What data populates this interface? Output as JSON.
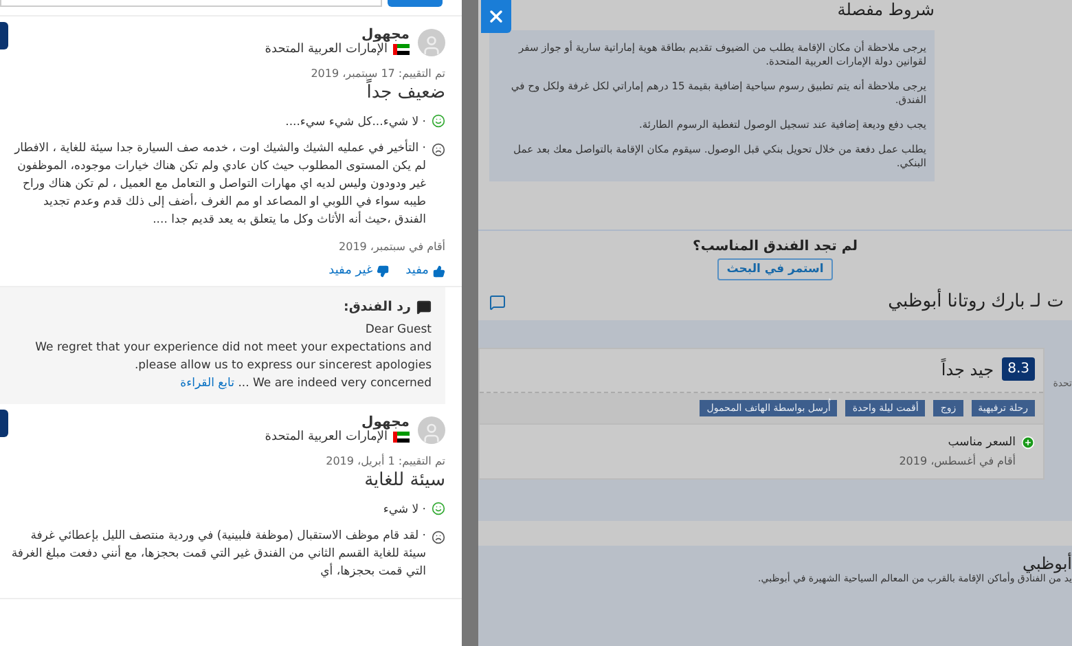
{
  "review_panel": {
    "reviews": [
      {
        "reviewer": "مجهول",
        "country": "الإمارات العربية المتحدة",
        "review_date": "تم التقييم: 17 سبتمبر، 2019",
        "title": "ضعيف جداً",
        "liked": "· لا شيء...كل شيء سيء....",
        "disliked": "· التأخير في عمليه الشيك والشيك اوت ، خدمه صف السيارة جدا سيئة للغاية ، الافطار لم يكن المستوى المطلوب حيث كان عادي ولم تكن هناك خيارات موجوده، الموظفون غير ودودون وليس لديه اي مهارات التواصل و التعامل مع العميل ، لم تكن هناك وراح طيبه سواء في اللوبي او المصاعد او مم الغرف ،أضف إلى ذلك قدم وعدم تجديد الفندق ،حيث أنه الأثاث وكل ما يتعلق به يعد قديم جدا ....",
        "stay_date": "أقام في سبتمبر، 2019",
        "helpful": "مفيد",
        "not_helpful": "غير مفيد",
        "hotel_reply": {
          "heading": "رد الفندق:",
          "greeting": "Dear Guest",
          "body": "We regret that your experience did not meet your expectations and please allow us to express our sincerest apologies.",
          "last_line": "We are indeed very concerned ...",
          "read_more": "تابع القراءة"
        }
      },
      {
        "reviewer": "مجهول",
        "country": "الإمارات العربية المتحدة",
        "review_date": "تم التقييم: 1 أبريل، 2019",
        "title": "سيئة للغاية",
        "liked": "· لا شيء",
        "disliked": "· لقد قام موظف الاستقبال (موظفة فلبينية) في وردية منتصف الليل بإعطائي غرفة سيئة للغاية القسم الثاني من الفندق غير التي قمت بحجزها، مع أنني دفعت مبلغ الغرفة التي قمت بحجزها، أي"
      }
    ]
  },
  "terms": {
    "heading": "شروط مفصلة",
    "paragraphs": [
      "يرجى ملاحظة أن مكان الإقامة يطلب من الضيوف تقديم بطاقة هوية إماراتية سارية أو جواز سفر لقوانين دولة الإمارات العربية المتحدة.",
      "يرجى ملاحظة أنه يتم تطبيق رسوم سياحية إضافية بقيمة 15 درهم إماراتي لكل غرفة ولكل وح في الفندق.",
      "يجب دفع وديعة إضافية عند تسجيل الوصول لتغطية الرسوم الطارئة.",
      "يطلب عمل دفعة من خلال تحويل بنكي قبل الوصول. سيقوم مكان الإقامة بالتواصل معك بعد عمل البنكي."
    ]
  },
  "search_prompt": {
    "question": "لم تجد الفندق المناسب؟",
    "button": "استمر في البحث"
  },
  "reviews_section": {
    "heading": "ت لـ بارك روتانا أبوظبي",
    "side_label": "تحدة",
    "card": {
      "score": "8.3",
      "rating": "جيد جداً",
      "tags": [
        "رحلة ترفيهية",
        "زوج",
        "أقمت ليلة واحدة",
        "أُرسل بواسطة الهاتف المحمول"
      ],
      "pro": "السعر مناسب",
      "stay_date": "أقام في أغسطس، 2019"
    }
  },
  "area": {
    "heading": "أبوظبي",
    "text": "يد من الفنادق وأماكن الإقامة بالقرب من المعالم السياحية الشهيرة في أبوظبي."
  }
}
